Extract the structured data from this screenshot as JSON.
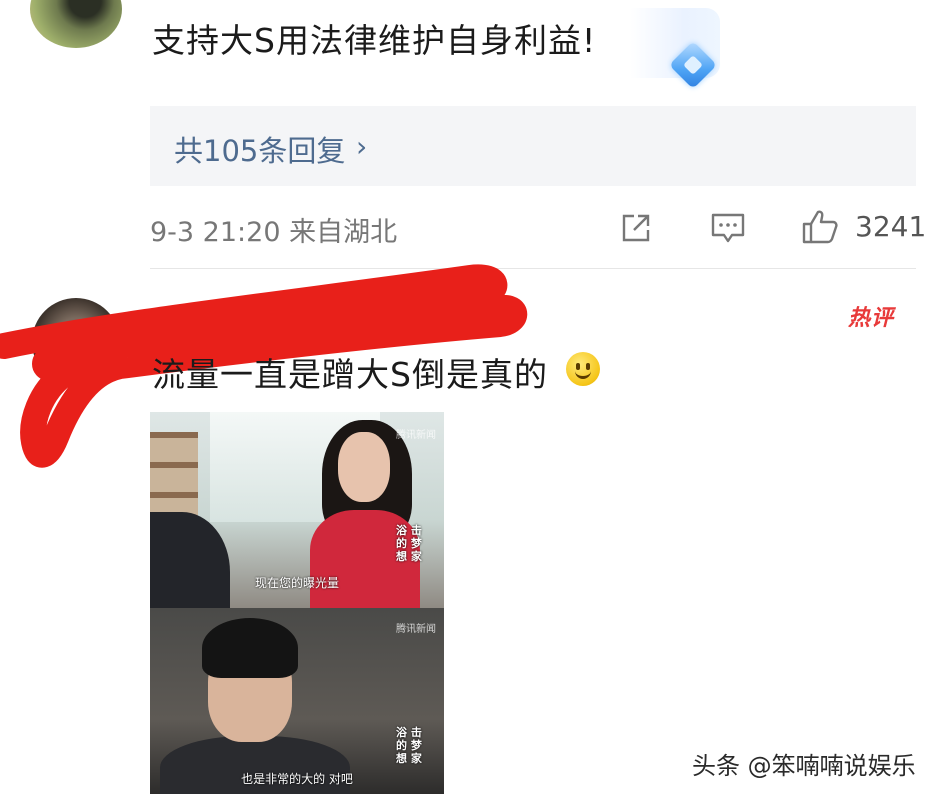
{
  "comment1": {
    "text": "支持大S用法律维护自身利益!",
    "replies_label": "共105条回复",
    "replies_chevron": "›",
    "meta": "9-3 21:20  来自湖北",
    "like_count": "3241",
    "icons": [
      "share-icon",
      "comment-icon",
      "like-icon"
    ]
  },
  "comment2": {
    "username": "...",
    "hot_tag": "热评",
    "text": "流量一直是蹭大S倒是真的",
    "emoji": "smile-icon",
    "image": {
      "top_subtitle": "现在您的曝光量",
      "bottom_subtitle": "也是非常的大的 对吧",
      "vertical_text": "浴 击 的 梦 想 家",
      "watermark": "腾讯新闻"
    }
  },
  "footer_watermark": "头条 @笨喃喃说娱乐",
  "colors": {
    "link_blue": "#4e6b8f",
    "hot_red": "#e83a3a",
    "scribble_red": "#e8201a"
  }
}
